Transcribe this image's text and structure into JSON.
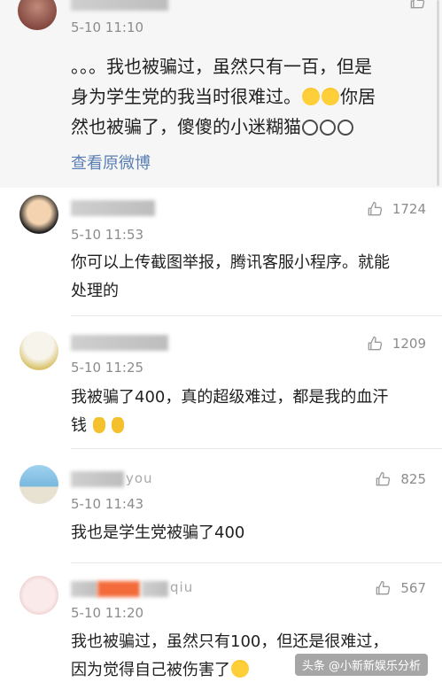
{
  "top_comment": {
    "time": "5-10 11:10",
    "text_1": "。。。我也被骗过，虽然只有一百，但是",
    "text_2": "身为学生党的我当时很难过。",
    "text_3": "你居",
    "text_4": "然也被骗了，傻傻的小迷糊猫",
    "link": "查看原微博",
    "emojis": [
      "laugh",
      "laugh",
      "face",
      "face",
      "face"
    ]
  },
  "comments": [
    {
      "time": "5-10 11:53",
      "likes": "1724",
      "line1": "你可以上传截图举报，腾讯客服小程序。就能",
      "line2": "处理的"
    },
    {
      "time": "5-10 11:25",
      "likes": "1209",
      "line1": "我被骗了400，真的超级难过，都是我的血汗",
      "line2": "钱",
      "emojis": [
        "sad",
        "sad"
      ]
    },
    {
      "name_partial": "you",
      "time": "5-10 11:43",
      "likes": "825",
      "line1": "我也是学生党被骗了400"
    },
    {
      "name_partial": "qiu",
      "time": "5-10 11:20",
      "likes": "567",
      "line1": "我也被骗过，虽然只有100，但还是很难过，",
      "line2": "因为觉得自己被伤害了",
      "emojis": [
        "laugh"
      ]
    }
  ],
  "watermark": "头条 @小新新娱乐分析",
  "colors": {
    "link": "#5a7fb3",
    "time": "#8c8c8c",
    "highlight_name": "#f36b3b"
  }
}
